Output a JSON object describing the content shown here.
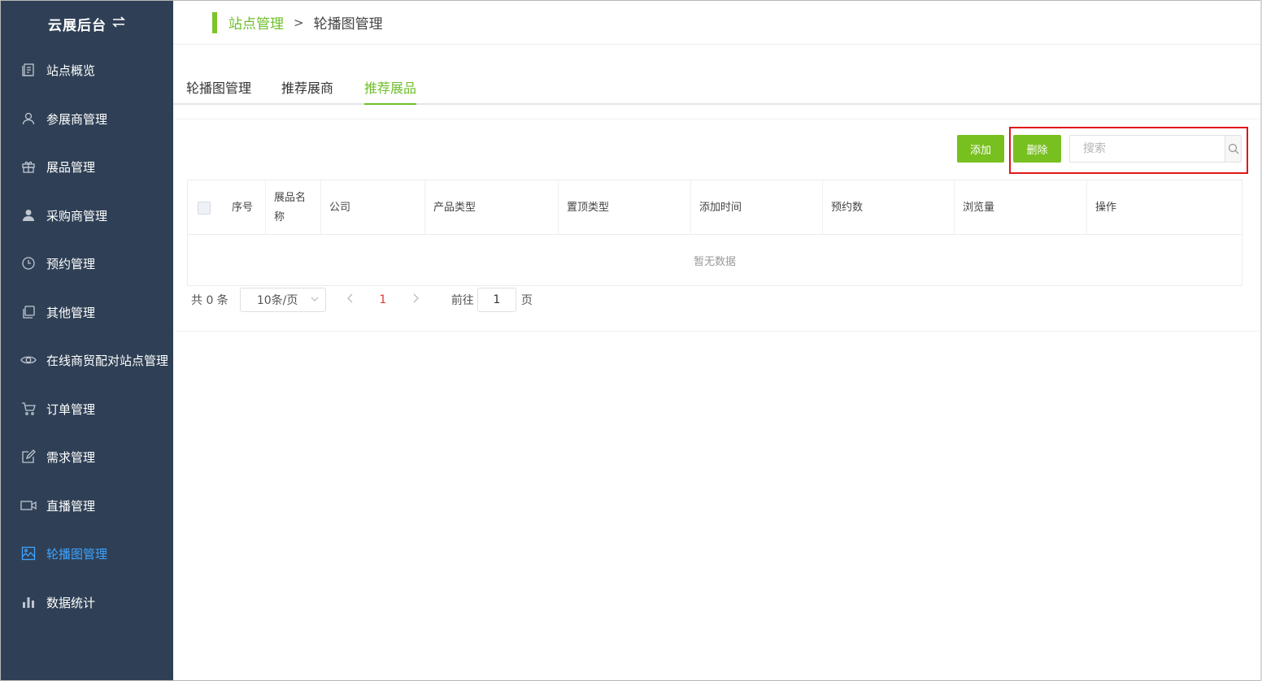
{
  "sidebar": {
    "brand": "云展后台",
    "brand_icon": "swap-icon",
    "items": [
      {
        "label": "站点概览",
        "icon": "overview-icon"
      },
      {
        "label": "参展商管理",
        "icon": "user-icon"
      },
      {
        "label": "展品管理",
        "icon": "gift-icon"
      },
      {
        "label": "采购商管理",
        "icon": "person-filled-icon"
      },
      {
        "label": "预约管理",
        "icon": "clock-icon"
      },
      {
        "label": "其他管理",
        "icon": "copy-icon"
      },
      {
        "label": "在线商贸配对站点管理",
        "icon": "eye-icon"
      },
      {
        "label": "订单管理",
        "icon": "cart-icon"
      },
      {
        "label": "需求管理",
        "icon": "edit-icon"
      },
      {
        "label": "直播管理",
        "icon": "video-icon"
      },
      {
        "label": "轮播图管理",
        "icon": "image-icon",
        "active": true
      },
      {
        "label": "数据统计",
        "icon": "bar-chart-icon"
      }
    ]
  },
  "breadcrumb": {
    "parent": "站点管理",
    "separator": ">",
    "current": "轮播图管理"
  },
  "tabs": [
    {
      "label": "轮播图管理"
    },
    {
      "label": "推荐展商"
    },
    {
      "label": "推荐展品",
      "active": true
    }
  ],
  "toolbar": {
    "add_label": "添加",
    "delete_label": "删除",
    "search_placeholder": "搜索"
  },
  "table": {
    "columns": [
      "序号",
      "展品名称",
      "公司",
      "产品类型",
      "置顶类型",
      "添加时间",
      "预约数",
      "浏览量",
      "操作"
    ],
    "empty_text": "暂无数据"
  },
  "pagination": {
    "total_text": "共 0 条",
    "page_size": "10条/页",
    "current_page": "1",
    "goto_label": "前往",
    "goto_value": "1",
    "page_suffix": "页"
  },
  "colors": {
    "sidebar_bg": "#2f4056",
    "accent_green": "#78c01f",
    "active_blue": "#3fa3ff",
    "highlight_red": "#e0161b"
  }
}
